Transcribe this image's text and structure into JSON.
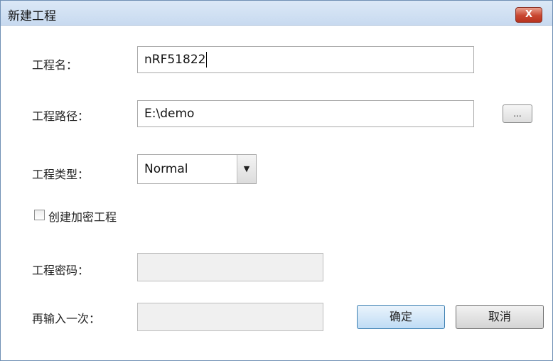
{
  "window": {
    "title": "新建工程",
    "close_label": "X"
  },
  "form": {
    "project_name_label": "工程名：",
    "project_name_value": "nRF51822",
    "project_path_label": "工程路径：",
    "project_path_value": "E:\\demo",
    "browse_label": "...",
    "project_type_label": "工程类型：",
    "project_type_value": "Normal",
    "encrypt_checkbox_label": "创建加密工程",
    "encrypt_checked": false,
    "password_label": "工程密码：",
    "password_value": "",
    "confirm_password_label": "再输入一次：",
    "confirm_password_value": ""
  },
  "buttons": {
    "ok_label": "确定",
    "cancel_label": "取消"
  },
  "icons": {
    "close": "close-icon",
    "dropdown": "chevron-down-icon"
  },
  "colors": {
    "titlebar": "#c8daf0",
    "close_button": "#c84630",
    "default_button_border": "#3c7fb1"
  }
}
